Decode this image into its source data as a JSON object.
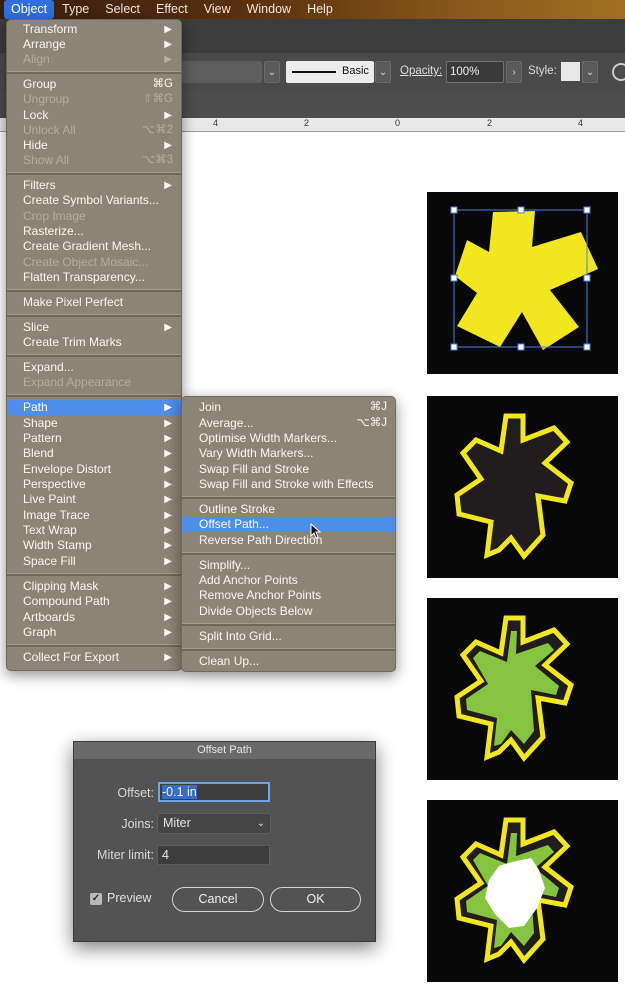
{
  "menubar": {
    "items": [
      "Object",
      "Type",
      "Select",
      "Effect",
      "View",
      "Window",
      "Help"
    ],
    "active": "Object"
  },
  "controlbar": {
    "stroke_style": "Basic",
    "opacity_label": "Opacity:",
    "opacity_value": "100%",
    "style_label": "Style:"
  },
  "ruler": {
    "ticks": [
      "4",
      "2",
      "0",
      "2",
      "4"
    ]
  },
  "object_menu": {
    "items": [
      {
        "label": "Transform",
        "submenu": true
      },
      {
        "label": "Arrange",
        "submenu": true
      },
      {
        "label": "Align",
        "submenu": true,
        "disabled": true
      },
      {
        "label": "Group",
        "shortcut": "⌘G"
      },
      {
        "label": "Ungroup",
        "shortcut": "⇧⌘G",
        "disabled": true
      },
      {
        "label": "Lock",
        "submenu": true
      },
      {
        "label": "Unlock All",
        "shortcut": "⌥⌘2",
        "disabled": true
      },
      {
        "label": "Hide",
        "submenu": true
      },
      {
        "label": "Show All",
        "shortcut": "⌥⌘3",
        "disabled": true
      },
      {
        "label": "Filters",
        "submenu": true
      },
      {
        "label": "Create Symbol Variants..."
      },
      {
        "label": "Crop Image",
        "disabled": true
      },
      {
        "label": "Rasterize..."
      },
      {
        "label": "Create Gradient Mesh..."
      },
      {
        "label": "Create Object Mosaic...",
        "disabled": true
      },
      {
        "label": "Flatten Transparency..."
      },
      {
        "label": "Make Pixel Perfect"
      },
      {
        "label": "Slice",
        "submenu": true
      },
      {
        "label": "Create Trim Marks"
      },
      {
        "label": "Expand..."
      },
      {
        "label": "Expand Appearance",
        "disabled": true
      },
      {
        "label": "Path",
        "submenu": true,
        "highlighted": true
      },
      {
        "label": "Shape",
        "submenu": true
      },
      {
        "label": "Pattern",
        "submenu": true
      },
      {
        "label": "Blend",
        "submenu": true
      },
      {
        "label": "Envelope Distort",
        "submenu": true
      },
      {
        "label": "Perspective",
        "submenu": true
      },
      {
        "label": "Live Paint",
        "submenu": true
      },
      {
        "label": "Image Trace",
        "submenu": true
      },
      {
        "label": "Text Wrap",
        "submenu": true
      },
      {
        "label": "Width Stamp",
        "submenu": true
      },
      {
        "label": "Space Fill",
        "submenu": true
      },
      {
        "label": "Clipping Mask",
        "submenu": true
      },
      {
        "label": "Compound Path",
        "submenu": true
      },
      {
        "label": "Artboards",
        "submenu": true
      },
      {
        "label": "Graph",
        "submenu": true
      },
      {
        "label": "Collect For Export",
        "submenu": true
      }
    ]
  },
  "path_submenu": {
    "items": [
      {
        "label": "Join",
        "shortcut": "⌘J"
      },
      {
        "label": "Average...",
        "shortcut": "⌥⌘J"
      },
      {
        "label": "Optimise Width Markers..."
      },
      {
        "label": "Vary Width Markers..."
      },
      {
        "label": "Swap Fill and Stroke"
      },
      {
        "label": "Swap Fill and Stroke with Effects"
      },
      {
        "label": "Outline Stroke"
      },
      {
        "label": "Offset Path...",
        "highlighted": true
      },
      {
        "label": "Reverse Path Direction"
      },
      {
        "label": "Simplify..."
      },
      {
        "label": "Add Anchor Points"
      },
      {
        "label": "Remove Anchor Points"
      },
      {
        "label": "Divide Objects Below"
      },
      {
        "label": "Split Into Grid..."
      },
      {
        "label": "Clean Up..."
      }
    ]
  },
  "dialog": {
    "title": "Offset Path",
    "offset_label": "Offset:",
    "offset_value": "-0.1 in",
    "joins_label": "Joins:",
    "joins_value": "Miter",
    "miter_label": "Miter limit:",
    "miter_value": "4",
    "preview_label": "Preview",
    "preview_checked": true,
    "cancel_label": "Cancel",
    "ok_label": "OK"
  },
  "colors": {
    "gear_yellow": "#f2e61e",
    "gear_green": "#86c440",
    "menu_bg": "#8c8477",
    "highlight": "#4d8ee8",
    "artboard_bg": "#080808"
  }
}
